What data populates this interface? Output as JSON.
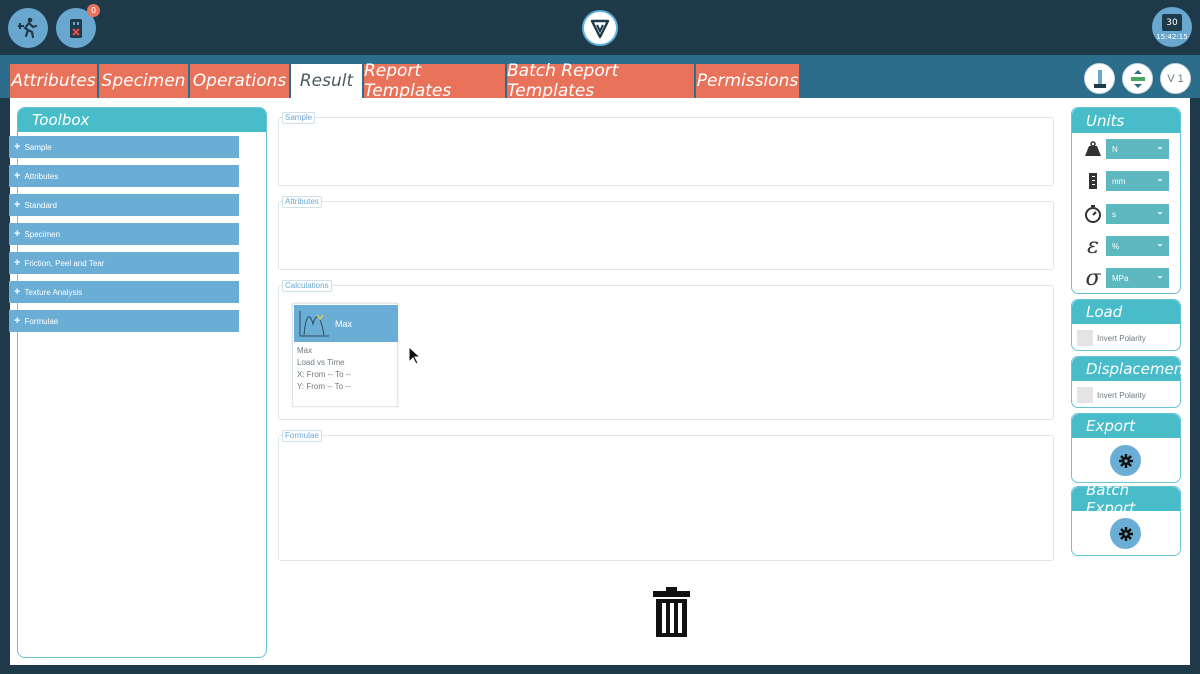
{
  "header": {
    "usb_badge": "0",
    "clock": {
      "day": "30",
      "time": "15:42:15"
    }
  },
  "tabs": [
    {
      "label": "Attributes",
      "active": false
    },
    {
      "label": "Specimen",
      "active": false
    },
    {
      "label": "Operations",
      "active": false
    },
    {
      "label": "Result",
      "active": true
    },
    {
      "label": "Report Templates",
      "active": false
    },
    {
      "label": "Batch Report Templates",
      "active": false
    },
    {
      "label": "Permissions",
      "active": false
    }
  ],
  "version_label": "V 1",
  "toolbox": {
    "title": "Toolbox",
    "items": [
      "Sample",
      "Attributes",
      "Standard",
      "Specimen",
      "Friction, Peel and Tear",
      "Texture Analysis",
      "Formulae"
    ]
  },
  "sections": {
    "sample": "Sample",
    "attributes": "Attributes",
    "calculations": "Calculations",
    "formulae": "Formulae"
  },
  "calculation_card": {
    "title": "Max",
    "lines": [
      "Max",
      "Load vs Time",
      "X: From -- To --",
      "Y: From -- To --"
    ]
  },
  "units": {
    "title": "Units",
    "rows": [
      {
        "icon": "weight-icon",
        "value": "N"
      },
      {
        "icon": "ruler-icon",
        "value": "mm"
      },
      {
        "icon": "stopwatch-icon",
        "value": "s"
      },
      {
        "icon": "epsilon-icon",
        "symbol": "ε",
        "value": "%"
      },
      {
        "icon": "sigma-icon",
        "symbol": "σ",
        "value": "MPa"
      }
    ]
  },
  "load": {
    "title": "Load",
    "checkbox_label": "Invert Polarity"
  },
  "displacement": {
    "title": "Displacement",
    "checkbox_label": "Invert Polarity"
  },
  "export": {
    "title": "Export"
  },
  "batch_export": {
    "title": "Batch Export"
  },
  "colors": {
    "accent_teal": "#48bcc9",
    "tab_orange": "#e8735a",
    "item_blue": "#6aaed6",
    "header_dark": "#1e3a4a"
  }
}
